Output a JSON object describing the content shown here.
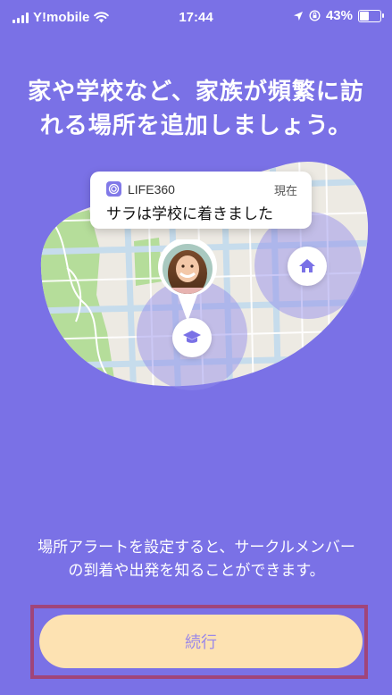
{
  "status_bar": {
    "carrier": "Y!mobile",
    "time": "17:44",
    "battery": "43%",
    "battery_level": 0.43
  },
  "headline": "家や学校など、家族が頻繁に訪れる場所を追加しましょう。",
  "notification": {
    "app_name": "LIFE360",
    "time": "現在",
    "message": "サラは学校に着きました"
  },
  "description": "場所アラートを設定すると、サークルメンバーの到着や出発を知ることができます。",
  "continue_button": {
    "label": "続行"
  },
  "colors": {
    "background": "#7a71e6",
    "button": "#fde2b2",
    "button_text": "#9b88e8",
    "highlight_frame": "#a0457a"
  }
}
